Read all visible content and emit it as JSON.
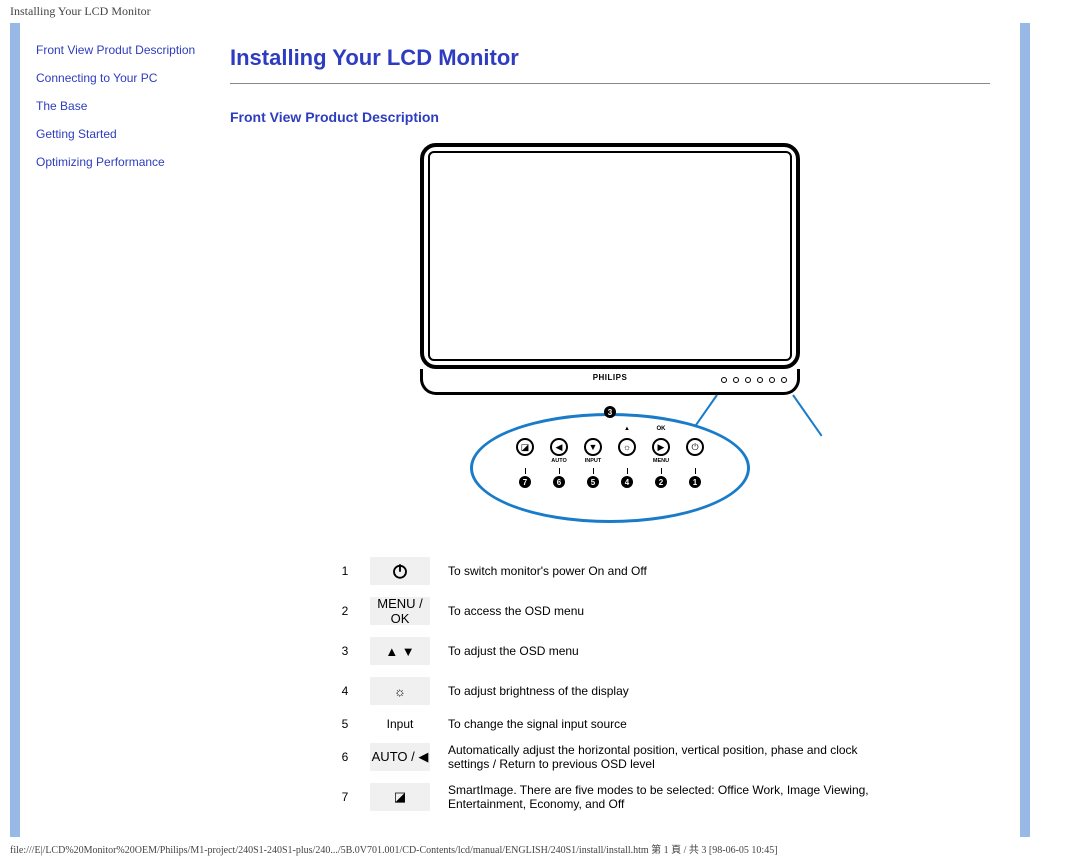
{
  "header_title": "Installing Your LCD Monitor",
  "sidebar": {
    "items": [
      {
        "label": "Front View Produt Description"
      },
      {
        "label": "Connecting to Your PC"
      },
      {
        "label": "The Base"
      },
      {
        "label": "Getting Started"
      },
      {
        "label": "Optimizing Performance"
      }
    ]
  },
  "content": {
    "main_title": "Installing Your LCD Monitor",
    "section_title": "Front View Product Description",
    "brand": "PHILIPS"
  },
  "panel": {
    "top_number": "3",
    "buttons": [
      {
        "icon": "◪",
        "top": "",
        "sub": "",
        "num": "7"
      },
      {
        "icon": "◀",
        "top": "",
        "sub": "AUTO",
        "num": "6"
      },
      {
        "icon": "▼",
        "top": "",
        "sub": "INPUT",
        "num": "5"
      },
      {
        "icon": "☼",
        "top": "▲",
        "sub": "",
        "num": "4"
      },
      {
        "icon": "▶",
        "top": "OK",
        "sub": "MENU",
        "num": "2"
      },
      {
        "icon": "⏻",
        "top": "",
        "sub": "",
        "num": "1"
      }
    ]
  },
  "legend": [
    {
      "n": "1",
      "icon_text": "⏻",
      "icon_type": "power",
      "desc": "To switch monitor's power On and Off"
    },
    {
      "n": "2",
      "icon_text": "MENU / OK",
      "icon_type": "text",
      "desc": "To access the OSD menu"
    },
    {
      "n": "3",
      "icon_text": "▲ ▼",
      "icon_type": "text",
      "desc": "To adjust the OSD menu"
    },
    {
      "n": "4",
      "icon_text": "☼",
      "icon_type": "text",
      "desc": "To adjust brightness of the display"
    },
    {
      "n": "5",
      "icon_text": "Input",
      "icon_type": "plain",
      "desc": "To change the signal input source"
    },
    {
      "n": "6",
      "icon_text": "AUTO / ◀",
      "icon_type": "text",
      "desc": "Automatically adjust the horizontal position, vertical position, phase and clock settings / Return to previous OSD level"
    },
    {
      "n": "7",
      "icon_text": "◪",
      "icon_type": "text",
      "desc": "SmartImage. There are five modes to be selected: Office Work, Image Viewing, Entertainment, Economy, and Off"
    }
  ],
  "footer": "file:///E|/LCD%20Monitor%20OEM/Philips/M1-project/240S1-240S1-plus/240.../5B.0V701.001/CD-Contents/lcd/manual/ENGLISH/240S1/install/install.htm 第 1 頁 / 共 3  [98-06-05 10:45]"
}
